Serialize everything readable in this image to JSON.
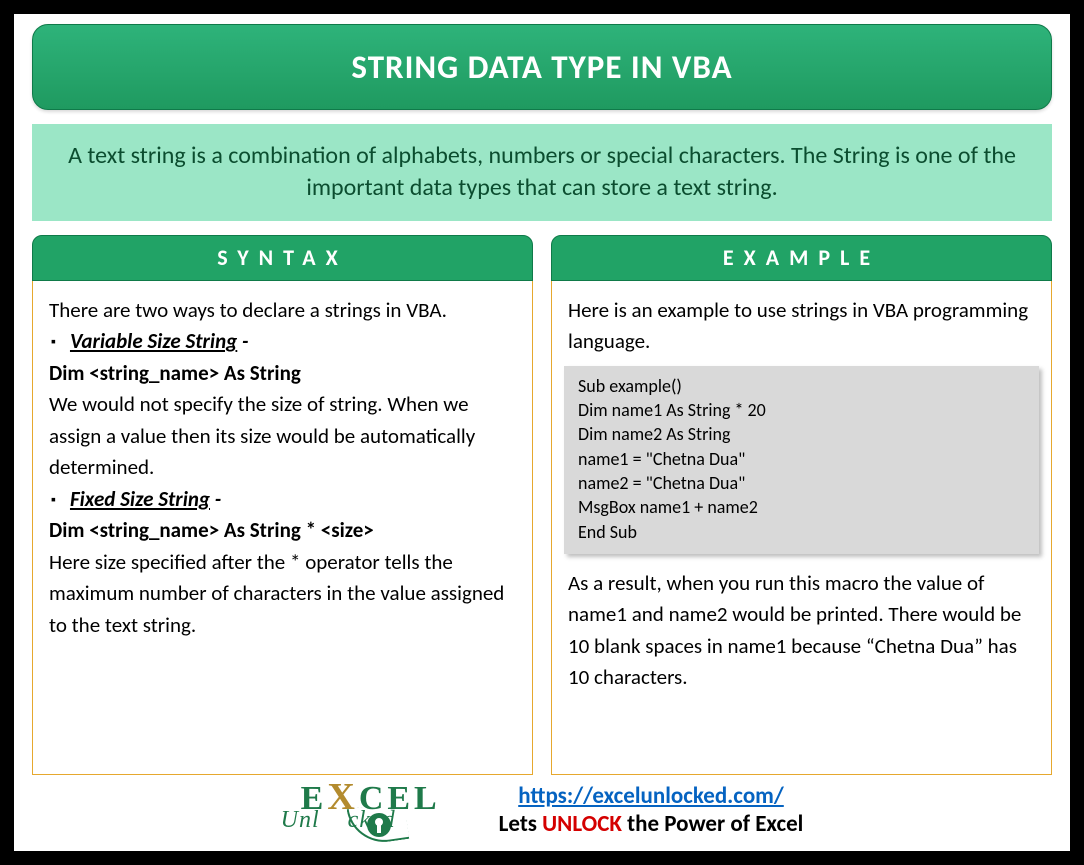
{
  "title": "STRING DATA TYPE IN VBA",
  "intro": "A text string is a combination of alphabets, numbers or special characters. The String is one of the important data types that can store a text string.",
  "syntax": {
    "header": "SYNTAX",
    "lead": "There are two ways to declare a strings in VBA.",
    "item1_label": "Variable Size String",
    "item1_dash": " -",
    "item1_code": "Dim <string_name> As String",
    "item1_desc": "We would not specify the size of string. When we assign a value then its size would be automatically determined.",
    "item2_label": "Fixed Size String",
    "item2_dash": " -",
    "item2_code": "Dim <string_name> As String * <size>",
    "item2_desc": "Here size specified after the * operator tells the maximum number of characters in the value assigned to the text string."
  },
  "example": {
    "header": "EXAMPLE",
    "lead": "Here is an example to use strings in VBA programming language.",
    "code": "Sub example()\nDim name1 As String * 20\nDim name2 As String\nname1 = \"Chetna Dua\"\nname2 = \"Chetna Dua\"\nMsgBox name1 + name2\nEnd Sub",
    "result": "As a result, when you run this macro the value of name1 and name2 would be printed. There would be 10 blank spaces in name1 because “Chetna Dua” has 10 characters."
  },
  "footer": {
    "url": "https://excelunlocked.com/",
    "slogan_pre": "Lets ",
    "slogan_unlock": "UNLOCK",
    "slogan_post": " the Power of Excel",
    "logo_top_e": "E",
    "logo_top_x": "X",
    "logo_top_rest": "CEL",
    "logo_bottom_pre": "Unl",
    "logo_bottom_post": "cked"
  }
}
